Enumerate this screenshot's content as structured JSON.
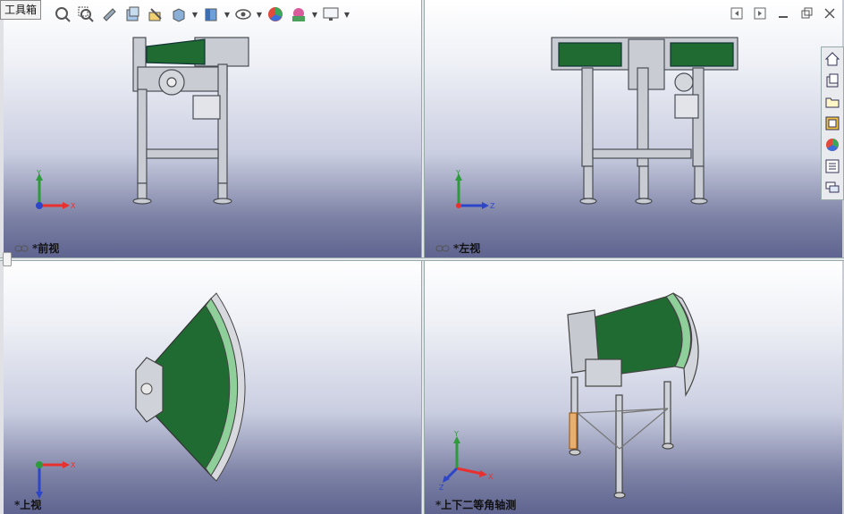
{
  "window": {
    "tab_label": "工具箱"
  },
  "toolbar": {
    "buttons": [
      "zoom-to-fit-icon",
      "zoom-to-area-icon",
      "previous-view-icon",
      "section-view-icon",
      "dynamic-annotation-icon",
      "view-orientation-icon",
      "display-style-icon",
      "hide-show-items-icon",
      "edit-appearance-icon",
      "apply-scene-icon",
      "view-settings-icon"
    ]
  },
  "viewports": {
    "front": {
      "label": "*前视",
      "axes": {
        "vertical": "Y",
        "horizontal": "X"
      }
    },
    "left": {
      "label": "*左视",
      "axes": {
        "vertical": "Y",
        "horizontal": "Z"
      }
    },
    "top": {
      "label": "*上视",
      "axes": {
        "vertical": "Z",
        "horizontal": "X"
      }
    },
    "iso": {
      "label": "*上下二等角轴测",
      "axes": {
        "vertical": "Y",
        "horizontal": "X",
        "depth": "Z"
      }
    }
  },
  "colors": {
    "belt": "#1f6b32",
    "frame": "#a9acb3",
    "axis_x": "#e8312f",
    "axis_y": "#2e9a3b",
    "axis_z": "#2d46c8"
  }
}
